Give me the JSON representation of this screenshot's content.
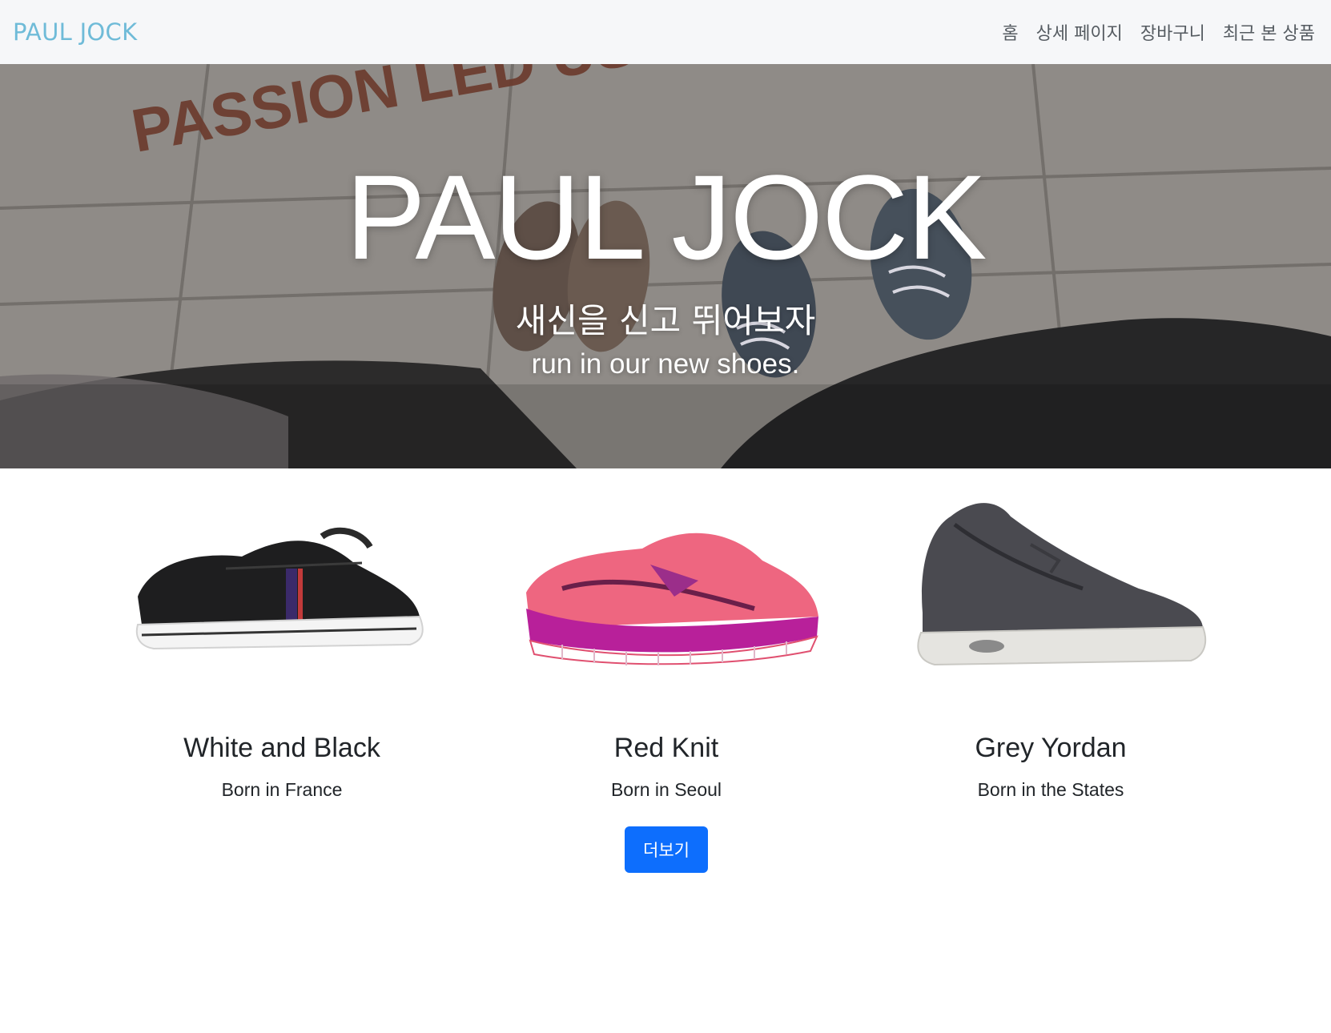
{
  "navbar": {
    "brand": "PAUL JOCK",
    "links": [
      "홈",
      "상세 페이지",
      "장바구니",
      "최근 본 상품"
    ]
  },
  "hero": {
    "title": "PAUL JOCK",
    "subtitle_ko": "새신을 신고 뛰어보자",
    "subtitle_en": "run in our new shoes.",
    "background_lettering": "PASSION LED US"
  },
  "products": [
    {
      "name": "White and Black",
      "origin": "Born in France",
      "image_icon": "black-sneaker-image"
    },
    {
      "name": "Red Knit",
      "origin": "Born in Seoul",
      "image_icon": "red-running-shoe-image"
    },
    {
      "name": "Grey Yordan",
      "origin": "Born in the States",
      "image_icon": "grey-high-top-image"
    }
  ],
  "more_button": {
    "label": "더보기"
  },
  "colors": {
    "brand": "#6fbbd8",
    "navbar_bg": "#f6f7f9",
    "primary_button": "#0d6efd"
  }
}
